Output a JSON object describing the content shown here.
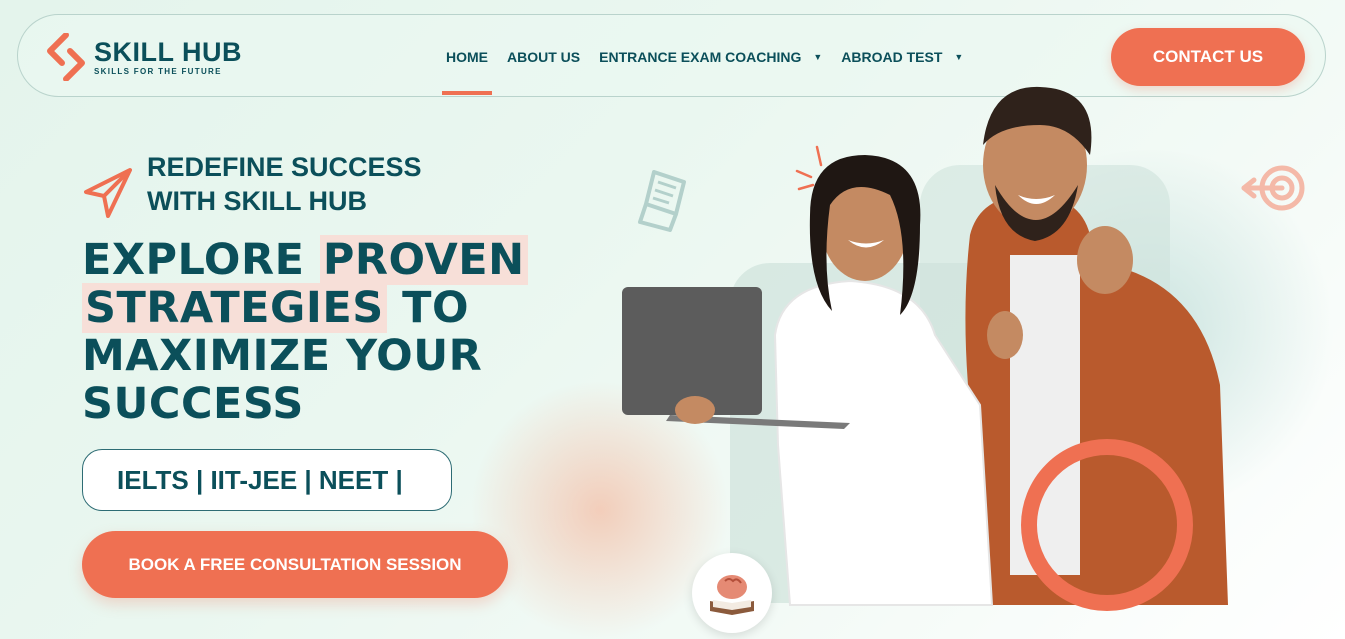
{
  "brand": {
    "name": "SKILL HUB",
    "tagline": "SKILLS FOR THE FUTURE",
    "primary_color": "#0b4f5a",
    "accent_color": "#ef7052"
  },
  "nav": {
    "items": [
      {
        "label": "HOME",
        "active": true,
        "dropdown": false
      },
      {
        "label": "ABOUT US",
        "active": false,
        "dropdown": false
      },
      {
        "label": "ENTRANCE EXAM COACHING",
        "active": false,
        "dropdown": true
      },
      {
        "label": "ABROAD TEST",
        "active": false,
        "dropdown": true
      }
    ],
    "contact_label": "CONTACT US"
  },
  "hero": {
    "tagline_line1": "REDEFINE SUCCESS",
    "tagline_line2": "WITH SKILL HUB",
    "headline_part1": "EXPLORE ",
    "headline_hl1": "PROVEN",
    "headline_hl2": "STRATEGIES",
    "headline_part2": " TO MAXIMIZE YOUR SUCCESS",
    "exams": "IELTS | IIT-JEE | NEET |",
    "cta_label": "BOOK A FREE CONSULTATION SESSION"
  },
  "icons": {
    "logo": "skill-hub-logo-icon",
    "plane": "paper-plane-icon",
    "book": "open-book-icon",
    "target": "target-arrow-icon",
    "brain": "brain-book-icon",
    "caret": "chevron-down-icon"
  }
}
